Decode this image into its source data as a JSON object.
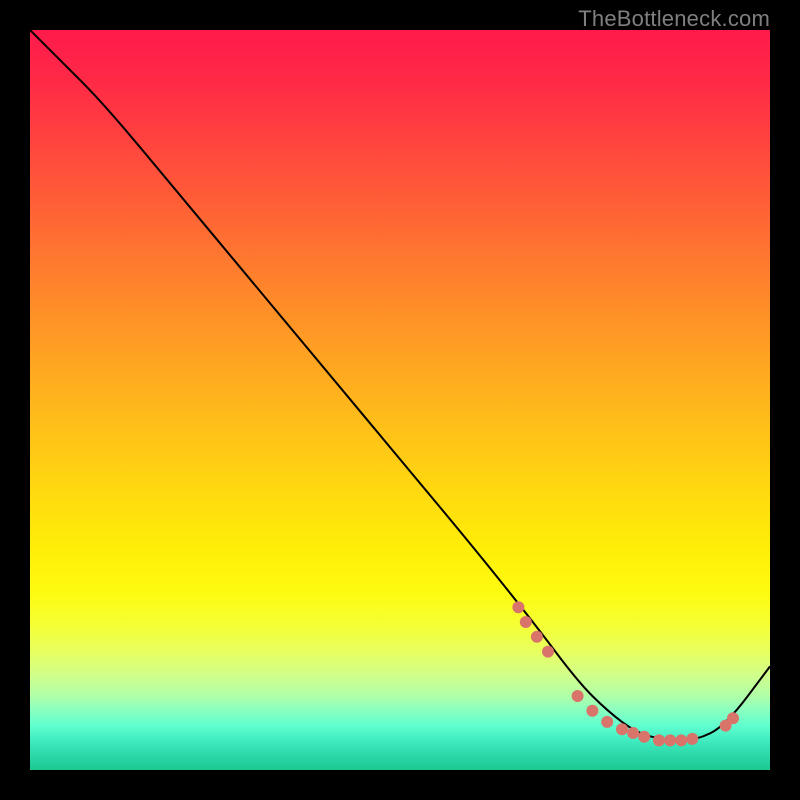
{
  "watermark": "TheBottleneck.com",
  "chart_data": {
    "type": "line",
    "title": "",
    "xlabel": "",
    "ylabel": "",
    "xlim": [
      0,
      100
    ],
    "ylim": [
      0,
      100
    ],
    "series": [
      {
        "name": "curve",
        "x": [
          0,
          4,
          10,
          20,
          30,
          40,
          50,
          60,
          68,
          74,
          78,
          82,
          86,
          90,
          94,
          100
        ],
        "y": [
          100,
          96,
          90,
          78,
          66,
          54,
          42,
          30,
          20,
          12,
          8,
          5,
          4,
          4,
          6,
          14
        ],
        "stroke": "#000000",
        "stroke_width": 2
      }
    ],
    "markers": [
      {
        "name": "marker-cluster",
        "shape": "circle",
        "color": "#d9746a",
        "radius": 6,
        "points_xy": [
          [
            66,
            22
          ],
          [
            67,
            20
          ],
          [
            68.5,
            18
          ],
          [
            70,
            16
          ],
          [
            74,
            10
          ],
          [
            76,
            8
          ],
          [
            78,
            6.5
          ],
          [
            80,
            5.5
          ],
          [
            81.5,
            5
          ],
          [
            83,
            4.5
          ],
          [
            85,
            4
          ],
          [
            86.5,
            4
          ],
          [
            88,
            4
          ],
          [
            89.5,
            4.2
          ],
          [
            94,
            6
          ],
          [
            95,
            7
          ]
        ]
      }
    ]
  }
}
